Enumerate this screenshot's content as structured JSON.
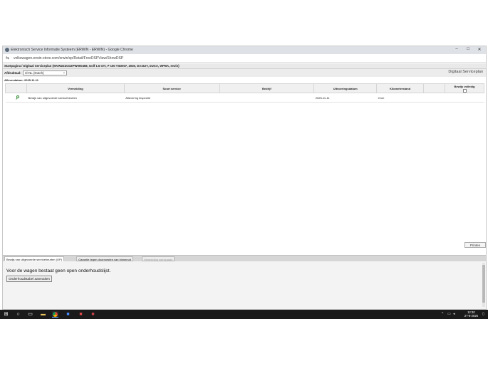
{
  "browser": {
    "window_title": "Elektronisch Service Informatie Systeem (ERWIN - ERWIN) - Google Chrome",
    "url": "volkswagen.erwin-store.com/erwin/sp/Retail/FreeDSPView/ShowDSP",
    "controls": {
      "minimize": "–",
      "maximize": "□",
      "close": "✕"
    }
  },
  "app": {
    "breadcrumb": "Startpagina / Digitaal Serviceplan (WVWZZZCDZPW000458, Golf 1.5 GTI, P 100 TSD007, 2026, DA16JY, DUCA, WPBA, erwin)",
    "language_label": "Afdruktaal:",
    "language_value": "nl-NL (Dutch)",
    "section_title": "Digitaal Serviceplan",
    "as_of": "Afleverdatum: 2025-11-11",
    "table": {
      "headers": [
        "",
        "Vermelding",
        "Soort service",
        "Bedrijf",
        "Uitvoeringsdatum",
        "Kilometerstand",
        "",
        "Bewijs volledig"
      ],
      "rows": [
        {
          "vermelding": "Bewijs van uitgevoerde serviceheurten",
          "soort": "Aflevering inspectie",
          "bedrijf": "",
          "datum": "2025-11-11",
          "km": "0 km"
        }
      ]
    },
    "print_label": "Printen",
    "tabs": [
      {
        "label": "Bewijs van uitgevoerde serviceheurten (OP)",
        "state": "active"
      },
      {
        "label": "Garantie tegen doorroesten van binnenuit",
        "state": "normal"
      },
      {
        "label": "Vermelding werkzaads",
        "state": "disabled"
      }
    ],
    "panel": {
      "message": "Voor de wagen bestaat geen open onderhoudslijst.",
      "create_button": "Onderhoudstabel aanmaken"
    }
  },
  "taskbar": {
    "time": "12:30",
    "date": "27-8-2026"
  }
}
